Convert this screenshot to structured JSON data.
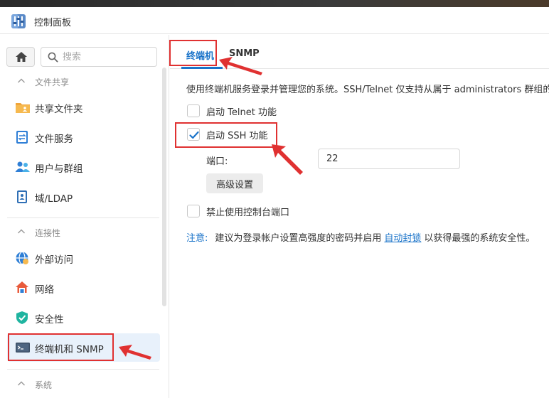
{
  "window": {
    "title": "控制面板"
  },
  "sidebar": {
    "search_placeholder": "搜索",
    "sections": [
      {
        "label": "文件共享"
      },
      {
        "label": "连接性"
      },
      {
        "label": "系统"
      }
    ],
    "items": [
      {
        "label": "共享文件夹",
        "icon": "shared-folder-icon"
      },
      {
        "label": "文件服务",
        "icon": "file-services-icon"
      },
      {
        "label": "用户与群组",
        "icon": "users-icon"
      },
      {
        "label": "域/LDAP",
        "icon": "domain-ldap-icon"
      },
      {
        "label": "外部访问",
        "icon": "external-access-icon"
      },
      {
        "label": "网络",
        "icon": "network-icon"
      },
      {
        "label": "安全性",
        "icon": "security-shield-icon"
      },
      {
        "label": "终端机和 SNMP",
        "icon": "terminal-icon",
        "selected": true
      }
    ]
  },
  "tabs": [
    {
      "label": "终端机",
      "active": true
    },
    {
      "label": "SNMP",
      "active": false
    }
  ],
  "terminal": {
    "description": "使用终端机服务登录并管理您的系统。SSH/Telnet 仅支持从属于 administrators 群组的",
    "telnet": {
      "label": "启动 Telnet 功能",
      "checked": false
    },
    "ssh": {
      "label": "启动 SSH 功能",
      "checked": true
    },
    "port_label": "端口:",
    "port_value": "22",
    "advanced_button": "高级设置",
    "console": {
      "label": "禁止使用控制台端口",
      "checked": false
    },
    "note_label": "注意:",
    "note_text_before": "建议为登录帐户设置高强度的密码并启用",
    "note_link": "自动封锁",
    "note_text_after": "以获得最强的系统安全性。"
  },
  "colors": {
    "accent": "#1a73c9",
    "annotation": "#e03131"
  }
}
